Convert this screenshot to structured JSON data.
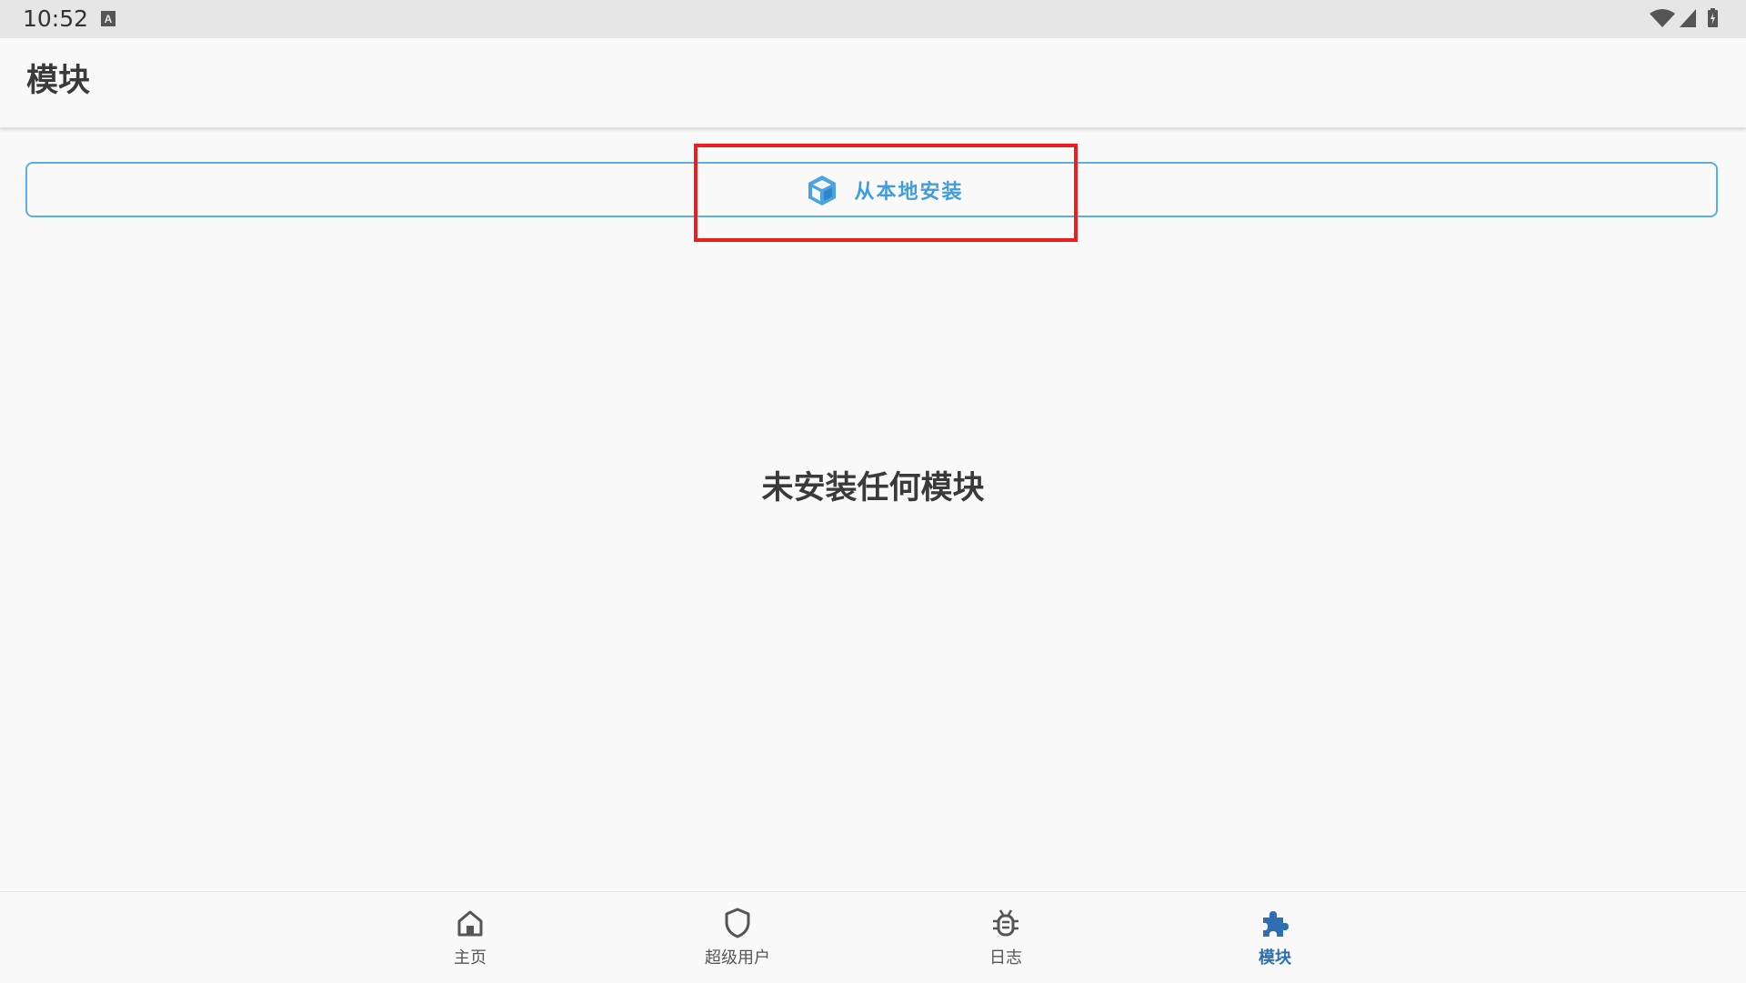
{
  "status_bar": {
    "time": "10:52",
    "icons": [
      "keyboard-a-icon",
      "wifi-icon",
      "signal-icon",
      "battery-icon"
    ]
  },
  "app_bar": {
    "title": "模块"
  },
  "install_button": {
    "label": "从本地安装",
    "icon": "box-icon"
  },
  "empty_state": {
    "message": "未安装任何模块"
  },
  "bottom_nav": {
    "items": [
      {
        "label": "主页",
        "icon": "home-icon",
        "active": false
      },
      {
        "label": "超级用户",
        "icon": "shield-icon",
        "active": false
      },
      {
        "label": "日志",
        "icon": "bug-icon",
        "active": false
      },
      {
        "label": "模块",
        "icon": "puzzle-icon",
        "active": true
      }
    ]
  },
  "colors": {
    "accent": "#3f9ee0",
    "active_nav": "#2f6eb0",
    "highlight": "#e8211f",
    "background": "#f9f9f9"
  }
}
